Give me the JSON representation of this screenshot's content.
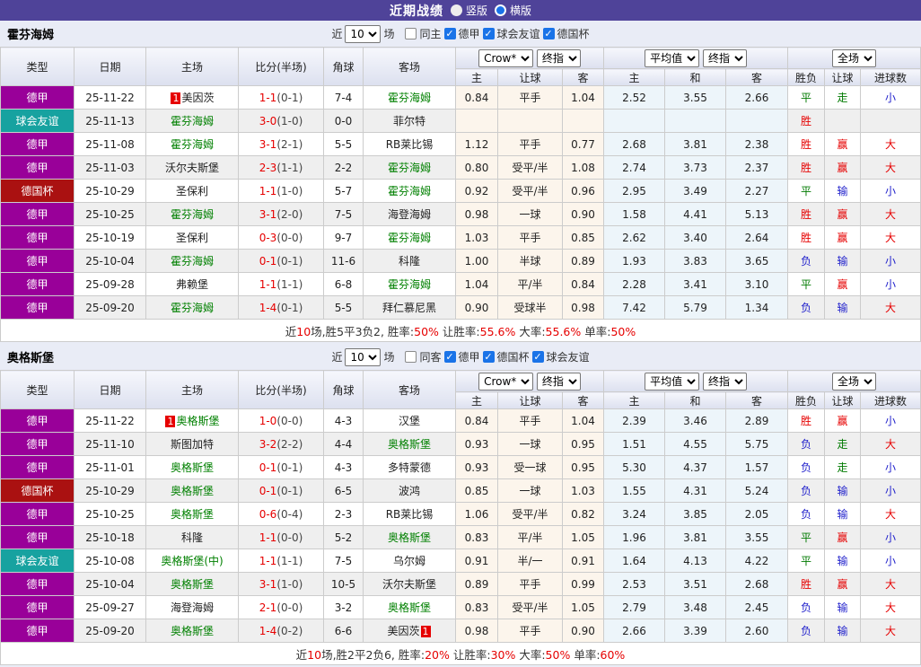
{
  "colors": {
    "accent_purple": "#4F4399",
    "league_colors": {
      "德甲": "#990099",
      "球会友谊": "#17A2A0",
      "德国杯": "#AA1111"
    },
    "team_green": "#008000",
    "win_red": "#E60000",
    "draw_green": "#007A00",
    "lose_blue": "#2222CC"
  },
  "title_bar": {
    "title": "近期战绩",
    "layouts": [
      {
        "label": "竖版",
        "checked": false
      },
      {
        "label": "横版",
        "checked": true
      }
    ]
  },
  "table_headers": {
    "type": "类型",
    "date": "日期",
    "home": "主场",
    "score": "比分(半场)",
    "corner": "角球",
    "away": "客场",
    "odds_sub": [
      "主",
      "让球",
      "客"
    ],
    "avg_sub": [
      "主",
      "和",
      "客"
    ],
    "result_sub": [
      "胜负",
      "让球",
      "进球数"
    ]
  },
  "sections": [
    {
      "team": "霍芬海姆",
      "controls": {
        "near_label": "近",
        "matches_value": "10",
        "games_label": "场",
        "same_venue": {
          "label": "同主",
          "checked": false
        },
        "leagues": [
          {
            "label": "德甲",
            "checked": true
          },
          {
            "label": "球会友谊",
            "checked": true
          },
          {
            "label": "德国杯",
            "checked": true
          }
        ]
      },
      "selects": {
        "odds_company": "Crow*",
        "odds_period": "终指",
        "avg_type": "平均值",
        "avg_period": "终指",
        "scope": "全场"
      },
      "rows": [
        {
          "type": "德甲",
          "date": "25-11-22",
          "home": {
            "name": "美因茨",
            "green": false,
            "badge": "1",
            "badge_side": "left"
          },
          "score": "1-1",
          "half": "(0-1)",
          "corner": "7-4",
          "away": {
            "name": "霍芬海姆",
            "green": true
          },
          "odds": [
            "0.84",
            "平手",
            "1.04"
          ],
          "avg": [
            "2.52",
            "3.55",
            "2.66"
          ],
          "results": [
            {
              "text": "平",
              "color": "green"
            },
            {
              "text": "走",
              "color": "green"
            },
            {
              "text": "小",
              "color": "blue"
            }
          ]
        },
        {
          "type": "球会友谊",
          "date": "25-11-13",
          "home": {
            "name": "霍芬海姆",
            "green": true
          },
          "score": "3-0",
          "half": "(1-0)",
          "corner": "0-0",
          "away": {
            "name": "菲尔特",
            "green": false
          },
          "odds": [
            "",
            "",
            ""
          ],
          "avg": [
            "",
            "",
            ""
          ],
          "results": [
            {
              "text": "胜",
              "color": "red"
            },
            {
              "text": "",
              "color": "red"
            },
            {
              "text": "",
              "color": "red"
            }
          ]
        },
        {
          "type": "德甲",
          "date": "25-11-08",
          "home": {
            "name": "霍芬海姆",
            "green": true
          },
          "score": "3-1",
          "half": "(2-1)",
          "corner": "5-5",
          "away": {
            "name": "RB莱比锡",
            "green": false
          },
          "odds": [
            "1.12",
            "平手",
            "0.77"
          ],
          "avg": [
            "2.68",
            "3.81",
            "2.38"
          ],
          "results": [
            {
              "text": "胜",
              "color": "red"
            },
            {
              "text": "赢",
              "color": "red"
            },
            {
              "text": "大",
              "color": "red"
            }
          ]
        },
        {
          "type": "德甲",
          "date": "25-11-03",
          "home": {
            "name": "沃尔夫斯堡",
            "green": false
          },
          "score": "2-3",
          "half": "(1-1)",
          "corner": "2-2",
          "away": {
            "name": "霍芬海姆",
            "green": true
          },
          "odds": [
            "0.80",
            "受平/半",
            "1.08"
          ],
          "avg": [
            "2.74",
            "3.73",
            "2.37"
          ],
          "results": [
            {
              "text": "胜",
              "color": "red"
            },
            {
              "text": "赢",
              "color": "red"
            },
            {
              "text": "大",
              "color": "red"
            }
          ]
        },
        {
          "type": "德国杯",
          "date": "25-10-29",
          "home": {
            "name": "圣保利",
            "green": false
          },
          "score": "1-1",
          "half": "(1-0)",
          "corner": "5-7",
          "away": {
            "name": "霍芬海姆",
            "green": true
          },
          "odds": [
            "0.92",
            "受平/半",
            "0.96"
          ],
          "avg": [
            "2.95",
            "3.49",
            "2.27"
          ],
          "results": [
            {
              "text": "平",
              "color": "green"
            },
            {
              "text": "输",
              "color": "blue"
            },
            {
              "text": "小",
              "color": "blue"
            }
          ]
        },
        {
          "type": "德甲",
          "date": "25-10-25",
          "home": {
            "name": "霍芬海姆",
            "green": true
          },
          "score": "3-1",
          "half": "(2-0)",
          "corner": "7-5",
          "away": {
            "name": "海登海姆",
            "green": false
          },
          "odds": [
            "0.98",
            "一球",
            "0.90"
          ],
          "avg": [
            "1.58",
            "4.41",
            "5.13"
          ],
          "results": [
            {
              "text": "胜",
              "color": "red"
            },
            {
              "text": "赢",
              "color": "red"
            },
            {
              "text": "大",
              "color": "red"
            }
          ]
        },
        {
          "type": "德甲",
          "date": "25-10-19",
          "home": {
            "name": "圣保利",
            "green": false
          },
          "score": "0-3",
          "half": "(0-0)",
          "corner": "9-7",
          "away": {
            "name": "霍芬海姆",
            "green": true
          },
          "odds": [
            "1.03",
            "平手",
            "0.85"
          ],
          "avg": [
            "2.62",
            "3.40",
            "2.64"
          ],
          "results": [
            {
              "text": "胜",
              "color": "red"
            },
            {
              "text": "赢",
              "color": "red"
            },
            {
              "text": "大",
              "color": "red"
            }
          ]
        },
        {
          "type": "德甲",
          "date": "25-10-04",
          "home": {
            "name": "霍芬海姆",
            "green": true
          },
          "score": "0-1",
          "half": "(0-1)",
          "corner": "11-6",
          "away": {
            "name": "科隆",
            "green": false
          },
          "odds": [
            "1.00",
            "半球",
            "0.89"
          ],
          "avg": [
            "1.93",
            "3.83",
            "3.65"
          ],
          "results": [
            {
              "text": "负",
              "color": "blue"
            },
            {
              "text": "输",
              "color": "blue"
            },
            {
              "text": "小",
              "color": "blue"
            }
          ]
        },
        {
          "type": "德甲",
          "date": "25-09-28",
          "home": {
            "name": "弗赖堡",
            "green": false
          },
          "score": "1-1",
          "half": "(1-1)",
          "corner": "6-8",
          "away": {
            "name": "霍芬海姆",
            "green": true
          },
          "odds": [
            "1.04",
            "平/半",
            "0.84"
          ],
          "avg": [
            "2.28",
            "3.41",
            "3.10"
          ],
          "results": [
            {
              "text": "平",
              "color": "green"
            },
            {
              "text": "赢",
              "color": "red"
            },
            {
              "text": "小",
              "color": "blue"
            }
          ]
        },
        {
          "type": "德甲",
          "date": "25-09-20",
          "home": {
            "name": "霍芬海姆",
            "green": true
          },
          "score": "1-4",
          "half": "(0-1)",
          "corner": "5-5",
          "away": {
            "name": "拜仁慕尼黑",
            "green": false
          },
          "odds": [
            "0.90",
            "受球半",
            "0.98"
          ],
          "avg": [
            "7.42",
            "5.79",
            "1.34"
          ],
          "results": [
            {
              "text": "负",
              "color": "blue"
            },
            {
              "text": "输",
              "color": "blue"
            },
            {
              "text": "大",
              "color": "red"
            }
          ]
        }
      ],
      "summary": [
        {
          "text": "近",
          "red": false
        },
        {
          "text": "10",
          "red": true
        },
        {
          "text": "场,胜5平3负2, 胜率:",
          "red": false
        },
        {
          "text": "50%",
          "red": true
        },
        {
          "text": " 让胜率:",
          "red": false
        },
        {
          "text": "55.6%",
          "red": true
        },
        {
          "text": " 大率:",
          "red": false
        },
        {
          "text": "55.6%",
          "red": true
        },
        {
          "text": " 单率:",
          "red": false
        },
        {
          "text": "50%",
          "red": true
        }
      ]
    },
    {
      "team": "奥格斯堡",
      "controls": {
        "near_label": "近",
        "matches_value": "10",
        "games_label": "场",
        "same_venue": {
          "label": "同客",
          "checked": false
        },
        "leagues": [
          {
            "label": "德甲",
            "checked": true
          },
          {
            "label": "德国杯",
            "checked": true
          },
          {
            "label": "球会友谊",
            "checked": true
          }
        ]
      },
      "selects": {
        "odds_company": "Crow*",
        "odds_period": "终指",
        "avg_type": "平均值",
        "avg_period": "终指",
        "scope": "全场"
      },
      "rows": [
        {
          "type": "德甲",
          "date": "25-11-22",
          "home": {
            "name": "奥格斯堡",
            "green": true,
            "badge": "1",
            "badge_side": "left"
          },
          "score": "1-0",
          "half": "(0-0)",
          "corner": "4-3",
          "away": {
            "name": "汉堡",
            "green": false
          },
          "odds": [
            "0.84",
            "平手",
            "1.04"
          ],
          "avg": [
            "2.39",
            "3.46",
            "2.89"
          ],
          "results": [
            {
              "text": "胜",
              "color": "red"
            },
            {
              "text": "赢",
              "color": "red"
            },
            {
              "text": "小",
              "color": "blue"
            }
          ]
        },
        {
          "type": "德甲",
          "date": "25-11-10",
          "home": {
            "name": "斯图加特",
            "green": false
          },
          "score": "3-2",
          "half": "(2-2)",
          "corner": "4-4",
          "away": {
            "name": "奥格斯堡",
            "green": true
          },
          "odds": [
            "0.93",
            "一球",
            "0.95"
          ],
          "avg": [
            "1.51",
            "4.55",
            "5.75"
          ],
          "results": [
            {
              "text": "负",
              "color": "blue"
            },
            {
              "text": "走",
              "color": "green"
            },
            {
              "text": "大",
              "color": "red"
            }
          ]
        },
        {
          "type": "德甲",
          "date": "25-11-01",
          "home": {
            "name": "奥格斯堡",
            "green": true
          },
          "score": "0-1",
          "half": "(0-1)",
          "corner": "4-3",
          "away": {
            "name": "多特蒙德",
            "green": false
          },
          "odds": [
            "0.93",
            "受一球",
            "0.95"
          ],
          "avg": [
            "5.30",
            "4.37",
            "1.57"
          ],
          "results": [
            {
              "text": "负",
              "color": "blue"
            },
            {
              "text": "走",
              "color": "green"
            },
            {
              "text": "小",
              "color": "blue"
            }
          ]
        },
        {
          "type": "德国杯",
          "date": "25-10-29",
          "home": {
            "name": "奥格斯堡",
            "green": true
          },
          "score": "0-1",
          "half": "(0-1)",
          "corner": "6-5",
          "away": {
            "name": "波鸿",
            "green": false
          },
          "odds": [
            "0.85",
            "一球",
            "1.03"
          ],
          "avg": [
            "1.55",
            "4.31",
            "5.24"
          ],
          "results": [
            {
              "text": "负",
              "color": "blue"
            },
            {
              "text": "输",
              "color": "blue"
            },
            {
              "text": "小",
              "color": "blue"
            }
          ]
        },
        {
          "type": "德甲",
          "date": "25-10-25",
          "home": {
            "name": "奥格斯堡",
            "green": true
          },
          "score": "0-6",
          "half": "(0-4)",
          "corner": "2-3",
          "away": {
            "name": "RB莱比锡",
            "green": false
          },
          "odds": [
            "1.06",
            "受平/半",
            "0.82"
          ],
          "avg": [
            "3.24",
            "3.85",
            "2.05"
          ],
          "results": [
            {
              "text": "负",
              "color": "blue"
            },
            {
              "text": "输",
              "color": "blue"
            },
            {
              "text": "大",
              "color": "red"
            }
          ]
        },
        {
          "type": "德甲",
          "date": "25-10-18",
          "home": {
            "name": "科隆",
            "green": false
          },
          "score": "1-1",
          "half": "(0-0)",
          "corner": "5-2",
          "away": {
            "name": "奥格斯堡",
            "green": true
          },
          "odds": [
            "0.83",
            "平/半",
            "1.05"
          ],
          "avg": [
            "1.96",
            "3.81",
            "3.55"
          ],
          "results": [
            {
              "text": "平",
              "color": "green"
            },
            {
              "text": "赢",
              "color": "red"
            },
            {
              "text": "小",
              "color": "blue"
            }
          ]
        },
        {
          "type": "球会友谊",
          "date": "25-10-08",
          "home": {
            "name": "奥格斯堡(中)",
            "green": true
          },
          "score": "1-1",
          "half": "(1-1)",
          "corner": "7-5",
          "away": {
            "name": "乌尔姆",
            "green": false
          },
          "odds": [
            "0.91",
            "半/一",
            "0.91"
          ],
          "avg": [
            "1.64",
            "4.13",
            "4.22"
          ],
          "results": [
            {
              "text": "平",
              "color": "green"
            },
            {
              "text": "输",
              "color": "blue"
            },
            {
              "text": "小",
              "color": "blue"
            }
          ]
        },
        {
          "type": "德甲",
          "date": "25-10-04",
          "home": {
            "name": "奥格斯堡",
            "green": true
          },
          "score": "3-1",
          "half": "(1-0)",
          "corner": "10-5",
          "away": {
            "name": "沃尔夫斯堡",
            "green": false
          },
          "odds": [
            "0.89",
            "平手",
            "0.99"
          ],
          "avg": [
            "2.53",
            "3.51",
            "2.68"
          ],
          "results": [
            {
              "text": "胜",
              "color": "red"
            },
            {
              "text": "赢",
              "color": "red"
            },
            {
              "text": "大",
              "color": "red"
            }
          ]
        },
        {
          "type": "德甲",
          "date": "25-09-27",
          "home": {
            "name": "海登海姆",
            "green": false
          },
          "score": "2-1",
          "half": "(0-0)",
          "corner": "3-2",
          "away": {
            "name": "奥格斯堡",
            "green": true
          },
          "odds": [
            "0.83",
            "受平/半",
            "1.05"
          ],
          "avg": [
            "2.79",
            "3.48",
            "2.45"
          ],
          "results": [
            {
              "text": "负",
              "color": "blue"
            },
            {
              "text": "输",
              "color": "blue"
            },
            {
              "text": "大",
              "color": "red"
            }
          ]
        },
        {
          "type": "德甲",
          "date": "25-09-20",
          "home": {
            "name": "奥格斯堡",
            "green": true
          },
          "score": "1-4",
          "half": "(0-2)",
          "corner": "6-6",
          "away": {
            "name": "美因茨",
            "green": false,
            "badge": "1",
            "badge_side": "right"
          },
          "odds": [
            "0.98",
            "平手",
            "0.90"
          ],
          "avg": [
            "2.66",
            "3.39",
            "2.60"
          ],
          "results": [
            {
              "text": "负",
              "color": "blue"
            },
            {
              "text": "输",
              "color": "blue"
            },
            {
              "text": "大",
              "color": "red"
            }
          ]
        }
      ],
      "summary": [
        {
          "text": "近",
          "red": false
        },
        {
          "text": "10",
          "red": true
        },
        {
          "text": "场,胜2平2负6, 胜率:",
          "red": false
        },
        {
          "text": "20%",
          "red": true
        },
        {
          "text": " 让胜率:",
          "red": false
        },
        {
          "text": "30%",
          "red": true
        },
        {
          "text": " 大率:",
          "red": false
        },
        {
          "text": "50%",
          "red": true
        },
        {
          "text": " 单率:",
          "red": false
        },
        {
          "text": "60%",
          "red": true
        }
      ]
    }
  ]
}
